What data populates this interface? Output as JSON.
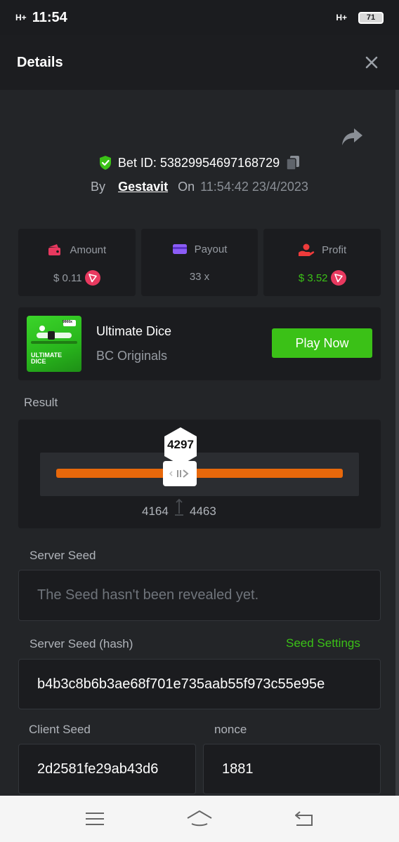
{
  "status_bar": {
    "signal_left": "H+",
    "time": "11:54",
    "signal_right": "H+",
    "battery": "71"
  },
  "header": {
    "title": "Details"
  },
  "bet": {
    "id_label": "Bet ID: 53829954697168729",
    "by_label": "By",
    "user": "Gestavit",
    "on_label": "On",
    "datetime": "11:54:42 23/4/2023"
  },
  "stats": [
    {
      "label": "Amount",
      "value": "$ 0.11",
      "icon": "wallet-icon",
      "color": "#e8395f"
    },
    {
      "label": "Payout",
      "value": "33 x",
      "icon": "card-icon",
      "color": "#8b5cf6"
    },
    {
      "label": "Profit",
      "value": "$ 3.52",
      "icon": "hand-coin-icon",
      "color": "#ee3b3b"
    }
  ],
  "game": {
    "title": "Ultimate Dice",
    "provider": "BC Originals",
    "play_label": "Play Now",
    "thumb_text_1": "ULTIMATE",
    "thumb_text_2": "DICE",
    "thumb_badge": "9900x"
  },
  "result": {
    "label": "Result",
    "value": "4297",
    "range_low": "4164",
    "range_high": "4463"
  },
  "server_seed": {
    "label": "Server Seed",
    "placeholder": "The Seed hasn't been revealed yet."
  },
  "server_seed_hash": {
    "label": "Server Seed (hash)",
    "settings_label": "Seed Settings",
    "value": "b4b3c8b6b3ae68f701e735aab55f973c55e95e"
  },
  "client_seed": {
    "label": "Client Seed",
    "value": "2d2581fe29ab43d6"
  },
  "nonce": {
    "label": "nonce",
    "value": "1881"
  },
  "colors": {
    "accent_green": "#3bc117",
    "track_orange": "#e8680b",
    "panel": "#1b1c1f",
    "background": "#232528"
  }
}
